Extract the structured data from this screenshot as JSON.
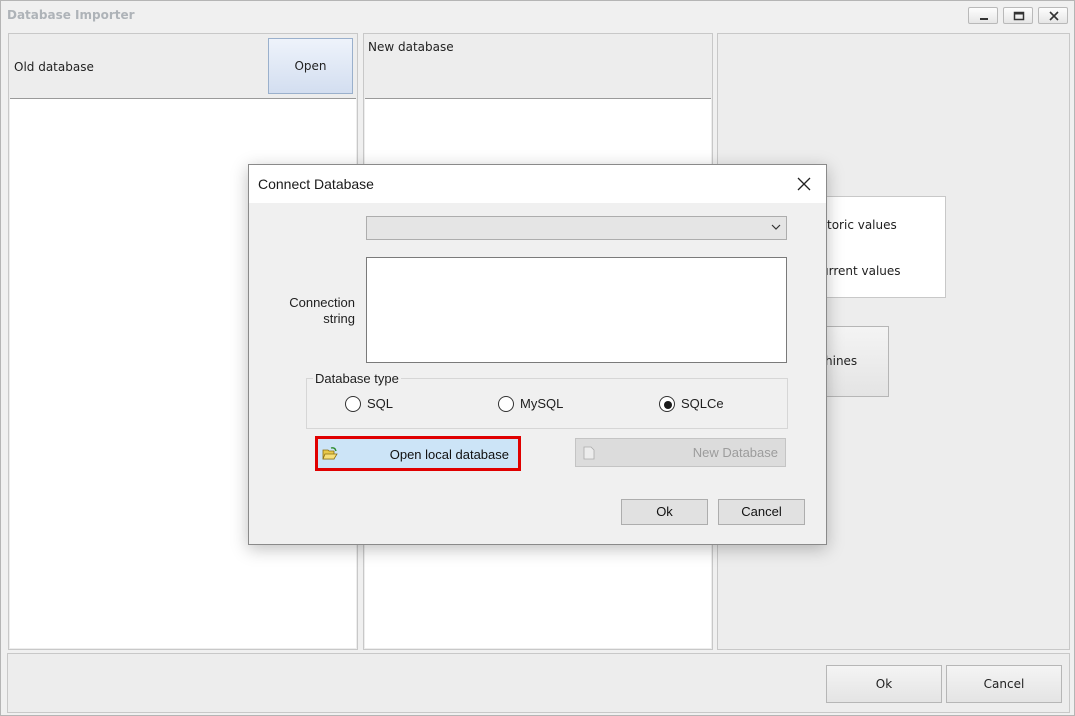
{
  "window": {
    "title": "Database Importer",
    "caption_buttons": [
      "minimize",
      "maximize",
      "close"
    ]
  },
  "old_panel": {
    "label": "Old database",
    "open_button": "Open"
  },
  "new_panel": {
    "label": "New database"
  },
  "right_panel": {
    "historic_label": "toric values",
    "current_label": "urrent values",
    "machines_button": "hines"
  },
  "footer": {
    "ok": "Ok",
    "cancel": "Cancel"
  },
  "dialog": {
    "title": "Connect Database",
    "combo_value": "",
    "connection_label": "Connection string",
    "connection_value": "",
    "db_type_label": "Database type",
    "radios": [
      {
        "label": "SQL",
        "checked": false
      },
      {
        "label": "MySQL",
        "checked": false
      },
      {
        "label": "SQLCe",
        "checked": true
      }
    ],
    "open_local": "Open local database",
    "new_database": "New Database",
    "ok": "Ok",
    "cancel": "Cancel"
  },
  "colors": {
    "highlight_border": "#e00000",
    "open_local_bg": "#cce4f7",
    "disabled_text": "#9c9c9c"
  }
}
